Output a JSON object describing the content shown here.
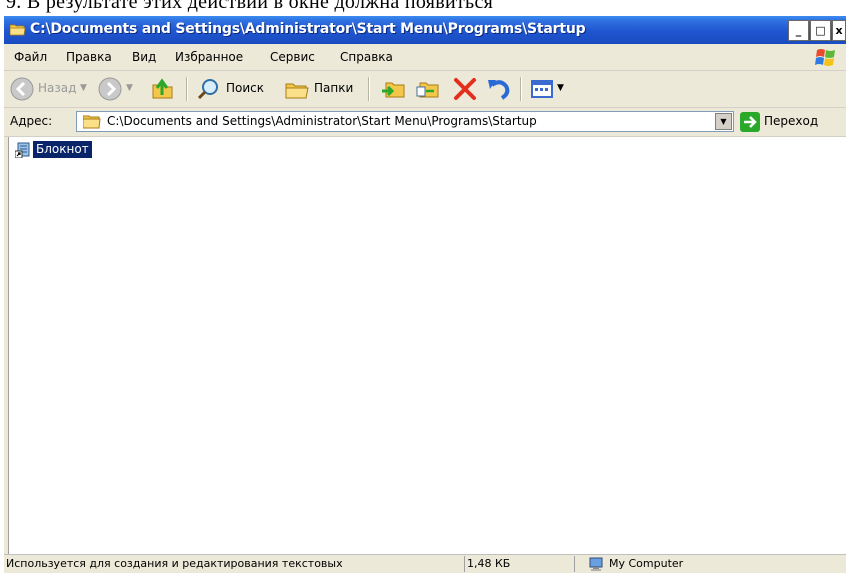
{
  "document": {
    "caption_fragment": "9.       В результате этих действий в окне должна появиться"
  },
  "window": {
    "title": "C:\\Documents and Settings\\Administrator\\Start Menu\\Programs\\Startup",
    "caption_buttons": {
      "minimize": "_",
      "maximize": "□",
      "close": "x"
    }
  },
  "menubar": {
    "items": [
      "Файл",
      "Правка",
      "Вид",
      "Избранное",
      "Сервис",
      "Справка"
    ]
  },
  "toolbar": {
    "back_label": "Назад",
    "search_label": "Поиск",
    "folders_label": "Папки"
  },
  "addressbar": {
    "label": "Адрес:",
    "value": "C:\\Documents and Settings\\Administrator\\Start Menu\\Programs\\Startup",
    "go_label": "Переход"
  },
  "content": {
    "items": [
      {
        "name": "Блокнот",
        "icon": "notepad-shortcut-icon",
        "selected": true
      }
    ]
  },
  "statusbar": {
    "description": "Используется для создания и редактирования текстовых",
    "size": "1,48 КБ",
    "zone": "My Computer"
  },
  "colors": {
    "titlebar": "#1f55d0",
    "selection": "#0a246a",
    "chrome": "#ece9d8"
  }
}
